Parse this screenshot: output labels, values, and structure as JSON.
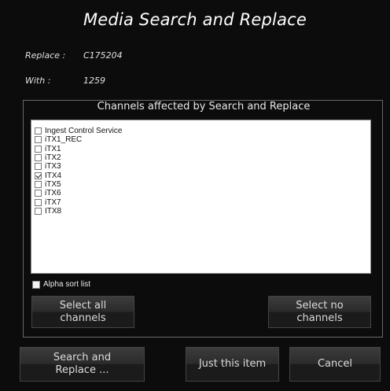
{
  "dialog": {
    "title": "Media Search and Replace",
    "replace_label": "Replace :",
    "replace_value": "C175204",
    "with_label": "With :",
    "with_value": "1259"
  },
  "channels": {
    "group_title": "Channels affected by Search and Replace",
    "items": [
      {
        "label": "Ingest Control Service",
        "checked": false
      },
      {
        "label": "iTX1_REC",
        "checked": false
      },
      {
        "label": "iTX1",
        "checked": false
      },
      {
        "label": "iTX2",
        "checked": false
      },
      {
        "label": "iTX3",
        "checked": false
      },
      {
        "label": "ITX4",
        "checked": true
      },
      {
        "label": "iTX5",
        "checked": false
      },
      {
        "label": "iTX6",
        "checked": false
      },
      {
        "label": "iTX7",
        "checked": false
      },
      {
        "label": "ITX8",
        "checked": false
      }
    ],
    "alpha_sort_label": "Alpha sort list",
    "alpha_sort_checked": false,
    "select_all_label": "Select all\nchannels",
    "select_none_label": "Select no\nchannels"
  },
  "footer": {
    "search_replace_label": "Search and\nReplace ...",
    "just_this_label": "Just this item",
    "cancel_label": "Cancel"
  }
}
